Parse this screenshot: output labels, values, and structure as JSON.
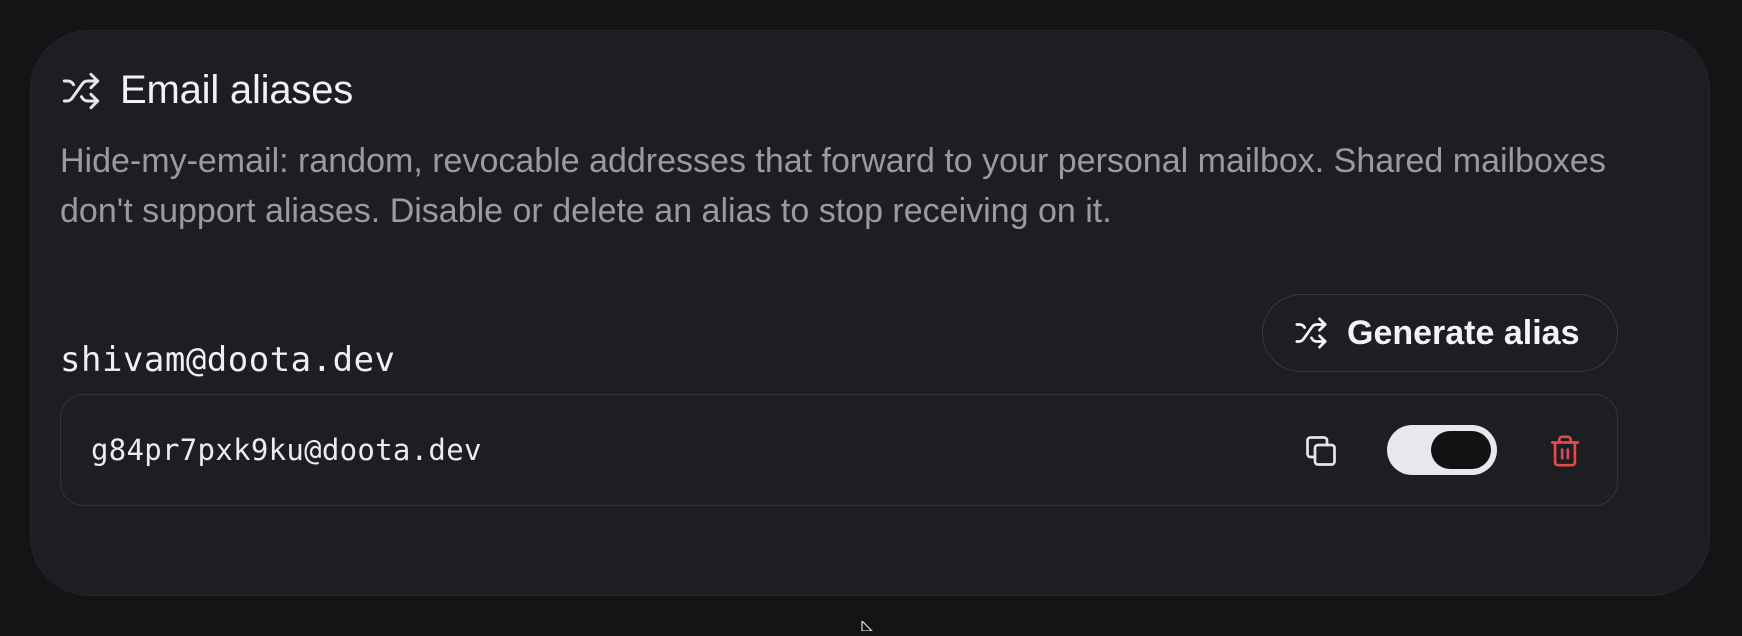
{
  "card": {
    "title": "Email aliases",
    "title_icon": "shuffle-icon",
    "description": "Hide-my-email: random, revocable addresses that forward to your personal mailbox. Shared mailboxes don't support aliases. Disable or delete an alias to stop receiving on it."
  },
  "mailbox": {
    "address": "shivam@doota.dev",
    "generate_button_label": "Generate alias",
    "generate_button_icon": "shuffle-icon"
  },
  "aliases": [
    {
      "address": "g84pr7pxk9ku@doota.dev",
      "enabled": true,
      "copy_icon": "copy-icon",
      "delete_icon": "trash-icon"
    }
  ],
  "colors": {
    "background": "#141417",
    "card": "#1d1e22",
    "text_primary": "#f2f2f4",
    "text_secondary": "#9a9aa2",
    "danger": "#e5484d",
    "toggle_on": "#e8e8ec"
  }
}
